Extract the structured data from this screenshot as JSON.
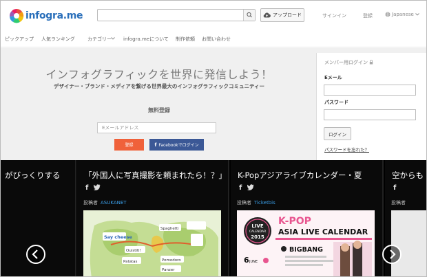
{
  "header": {
    "logo_text": "infogra.me",
    "upload_label": "アップロード",
    "signin_label": "サインイン",
    "register_label": "登録",
    "language_label": "Japanese"
  },
  "nav": {
    "items": [
      "ピックアップ",
      "人気ランキング",
      "カテゴリー",
      "infogra.meについて",
      "制作依頼",
      "お問い合わせ"
    ]
  },
  "hero": {
    "title": "インフォグラフィックを世界に発信しよう！",
    "subtitle": "デザイナー・ブランド・メディアを繋げる世界最大のインフォグラフィックコミュニティー",
    "register_title": "無料登録",
    "email_placeholder": "Eメールアドレス",
    "register_button": "登録",
    "facebook_button": "Facebookでログイン"
  },
  "login": {
    "title": "メンバー用ログイン",
    "email_label": "Eメール",
    "password_label": "パスワード",
    "login_button": "ログイン",
    "forgot_link": "パスワードを忘れた？"
  },
  "gallery": {
    "poster_prefix": "投稿者",
    "cards": [
      {
        "title": "がびっくりする"
      },
      {
        "title": "「外国人に写真撮影を頼まれたら！？」",
        "poster": "ASUKANET"
      },
      {
        "title": "K-Popアジアライブカレンダー・夏",
        "poster": "Ticketbis"
      },
      {
        "title": "空からも"
      }
    ],
    "kpop": {
      "line1": "K-POP",
      "line2": "ASIA LIVE CALENDAR",
      "badge_line1": "LIVE",
      "badge_line2": "CALENDAR",
      "badge_year": "2015",
      "artist": "BIGBANG",
      "date_num": "6",
      "date_month": "JUNE"
    },
    "map_labels": [
      "Say cheese",
      "Spaghetti",
      "Ouistiti!",
      "Patatas",
      "Pomodoro",
      "Panzer"
    ]
  },
  "colors": {
    "orange": "#f0613a",
    "facebook": "#3b5896",
    "link_blue": "#3a9ee8",
    "kpop_pink": "#e8558f"
  }
}
